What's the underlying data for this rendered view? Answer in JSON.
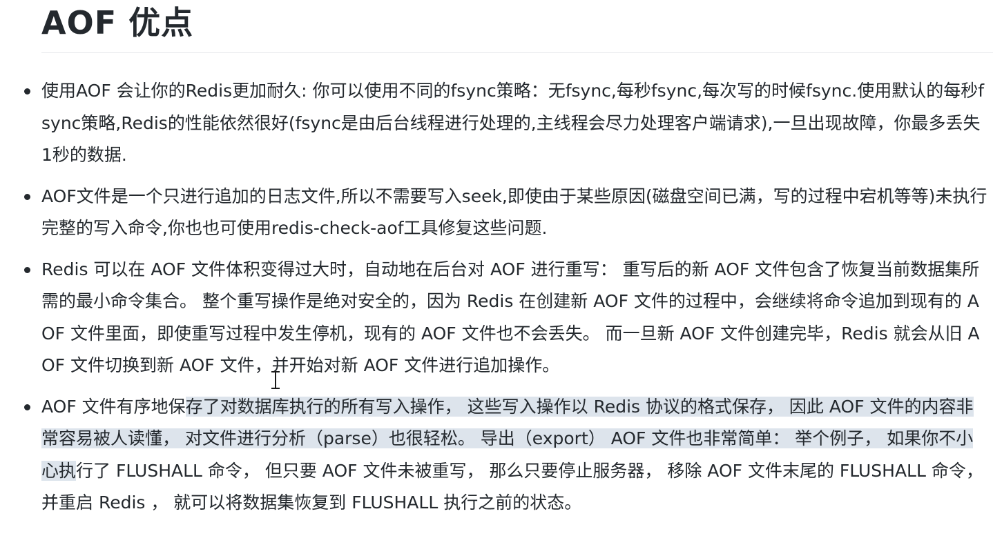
{
  "heading": "AOF 优点",
  "bullets": [
    {
      "text": "使用AOF 会让你的Redis更加耐久: 你可以使用不同的fsync策略：无fsync,每秒fsync,每次写的时候fsync.使用默认的每秒fsync策略,Redis的性能依然很好(fsync是由后台线程进行处理的,主线程会尽力处理客户端请求),一旦出现故障，你最多丢失1秒的数据."
    },
    {
      "text": "AOF文件是一个只进行追加的日志文件,所以不需要写入seek,即使由于某些原因(磁盘空间已满，写的过程中宕机等等)未执行完整的写入命令,你也也可使用redis-check-aof工具修复这些问题."
    },
    {
      "text": "Redis 可以在 AOF 文件体积变得过大时，自动地在后台对 AOF 进行重写： 重写后的新 AOF 文件包含了恢复当前数据集所需的最小命令集合。 整个重写操作是绝对安全的，因为 Redis 在创建新 AOF 文件的过程中，会继续将命令追加到现有的 AOF 文件里面，即使重写过程中发生停机，现有的 AOF 文件也不会丢失。 而一旦新 AOF 文件创建完毕，Redis 就会从旧 AOF 文件切换到新 AOF 文件，并开始对新 AOF 文件进行追加操作。"
    },
    {
      "text_before_selection": "AOF 文件有序地保",
      "text_selected": "存了对数据库执行的所有写入操作， 这些写入操作以 Redis 协议的格式保存， 因此 AOF 文件的内容非常容易被人读懂， 对文件进行分析（parse）也很轻松。 导出（export） AOF 文件也非常简单： 举个例子， 如果你不小心执",
      "text_after_selection": "行了 FLUSHALL 命令， 但只要 AOF 文件未被重写， 那么只要停止服务器， 移除 AOF 文件末尾的 FLUSHALL 命令， 并重启 Redis ， 就可以将数据集恢复到 FLUSHALL 执行之前的状态。"
    }
  ],
  "colors": {
    "text": "#24292e",
    "selection": "#dde4ec",
    "divider": "#e6e8eb"
  },
  "cursor_icon": "text-cursor-icon"
}
